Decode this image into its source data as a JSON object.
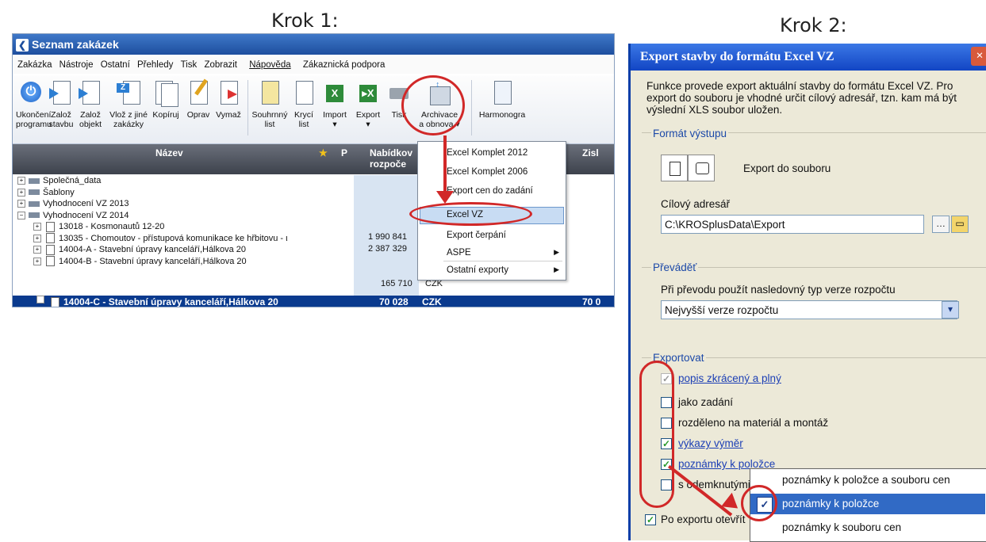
{
  "steps": {
    "step1": "Krok 1:",
    "step2": "Krok 2:"
  },
  "window1": {
    "title": "Seznam zakázek",
    "menu": [
      "Zakázka",
      "Nástroje",
      "Ostatní",
      "Přehledy",
      "Tisk",
      "Zobrazit",
      "Nápověda",
      "Zákaznická podpora"
    ],
    "toolbar": {
      "ukonceni": [
        "Ukončení",
        "programu"
      ],
      "zaloz_stavbu": [
        "Založ",
        "stavbu"
      ],
      "zaloz_objekt": [
        "Založ",
        "objekt"
      ],
      "vloz": [
        "Vlož z jiné",
        "zakázky"
      ],
      "kopiruj": "Kopíruj",
      "oprav": "Oprav",
      "vymaz": "Vymaž",
      "souhrnny": [
        "Souhrnný",
        "list"
      ],
      "kryci": [
        "Krycí",
        "list"
      ],
      "import": "Import",
      "export": "Export",
      "tisk": "Tisk",
      "archivace": [
        "Archivace",
        "a obnova ▾"
      ],
      "harmonogram": "Harmonogra"
    },
    "grid_head": {
      "nazev": "Název",
      "p": "P",
      "nabidkova": [
        "Nabídkov",
        "rozpoče"
      ],
      "zisk": "Zisl"
    },
    "tree": [
      {
        "label": "Společná_data"
      },
      {
        "label": "Šablony"
      },
      {
        "label": "Vyhodnocení VZ 2013"
      },
      {
        "label": "Vyhodnocení VZ 2014"
      },
      {
        "label": "13018 - Kosmonautů 12-20",
        "value": "1 990 841"
      },
      {
        "label": "13035 - Chomoutov - přístupová komunikace ke hřbitovu - ι",
        "value": "2 387 329"
      },
      {
        "label": "14004-A - Stavební úpravy kanceláří,Hálkova 20",
        "value": ""
      },
      {
        "label": "14004-B - Stavební úpravy kanceláří,Hálkova 20",
        "value": "165 710",
        "currency": "CZK"
      }
    ],
    "selected_row": {
      "label": "14004-C - Stavební úpravy kanceláří,Hálkova 20",
      "value": "70 028",
      "currency": "CZK",
      "extra": "70 0"
    },
    "dropdown": [
      "Excel Komplet 2012",
      "Excel Komplet 2006",
      "Export cen do zadání",
      "Excel VZ",
      "Export čerpání",
      "ASPE",
      "Ostatní exporty"
    ]
  },
  "window2": {
    "title": "Export stavby do formátu Excel VZ",
    "intro": "Funkce provede export aktuální stavby do formátu Excel VZ. Pro export do souboru je vhodné určit cílový adresář, tzn. kam má být výslední XLS soubor uložen.",
    "format_title": "Formát výstupu",
    "export_file": "Export do souboru",
    "target_label": "Cílový adresář",
    "target_value": "C:\\KROSplusData\\Export",
    "converter_title": "Převáděť",
    "converter_label": "Při převodu použít nasledovný typ verze rozpočtu",
    "converter_value": "Nejvyšší verze rozpočtu",
    "export_title": "Exportovat",
    "options": [
      {
        "label": "popis zkrácený a plný",
        "checked": true
      },
      {
        "label": "jako zadání",
        "checked": false
      },
      {
        "label": "rozděleno na materiál a montáž",
        "checked": false
      },
      {
        "label": "výkazy výměr",
        "checked": true
      },
      {
        "label": "poznámky k položce",
        "checked": true
      },
      {
        "label": "s odemknutými",
        "checked": false
      }
    ],
    "open_after": "Po exportu otevřít",
    "popup": [
      "poznámky k položce a souboru cen",
      "poznámky k položce",
      "poznámky k souboru cen"
    ]
  }
}
